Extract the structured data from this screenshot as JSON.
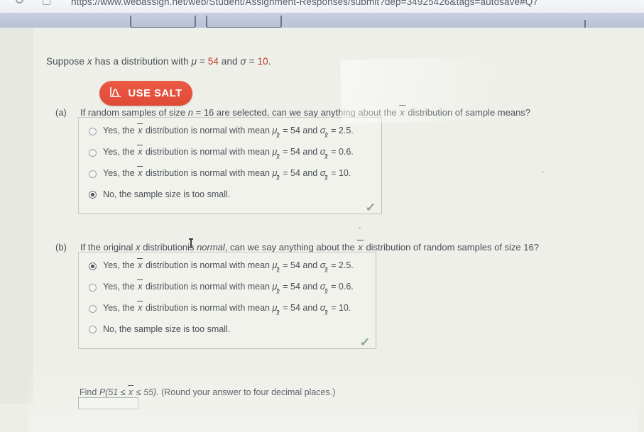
{
  "browser": {
    "url": "https://www.webassign.net/web/Student/Assignment-Responses/submit?dep=34925426&tags=autosave#Q7"
  },
  "problem": {
    "statement_prefix": "Suppose",
    "statement_var": "x",
    "statement_mid": "has a distribution with",
    "mu_symbol": "μ",
    "mu_value": "54",
    "and_text": "and",
    "sigma_symbol": "σ",
    "sigma_value": "10",
    "statement_period": "."
  },
  "salt_button": {
    "label": "USE SALT",
    "icon": "distribution-chart-icon",
    "color": "#e8503c"
  },
  "parts": [
    {
      "label": "(a)",
      "question": "If random samples of size n = 16 are selected, can we say anything about the x̄ distribution of sample means?",
      "question_pre": "If random samples of size",
      "question_n": "n",
      "question_n_eq": "= 16",
      "question_mid": "are selected, can we say anything about the",
      "question_post": "distribution of sample means?",
      "selected_index": 3,
      "options": [
        {
          "pre": "Yes, the",
          "mid": "distribution is normal with mean",
          "mu": "μ",
          "mu_sub": "x̄",
          "mu_eq": "= 54 and",
          "sigma": "σ",
          "sigma_sub": "x̄",
          "sigma_eq": "= 2.5."
        },
        {
          "pre": "Yes, the",
          "mid": "distribution is normal with mean",
          "mu": "μ",
          "mu_sub": "x̄",
          "mu_eq": "= 54 and",
          "sigma": "σ",
          "sigma_sub": "x̄",
          "sigma_eq": "= 0.6."
        },
        {
          "pre": "Yes, the",
          "mid": "distribution is normal with mean",
          "mu": "μ",
          "mu_sub": "x̄",
          "mu_eq": "= 54 and",
          "sigma": "σ",
          "sigma_sub": "x̄",
          "sigma_eq": "= 10."
        },
        {
          "plain": "No, the sample size is too small."
        }
      ],
      "feedback_icon": "green-checkmark-icon"
    },
    {
      "label": "(b)",
      "question": "If the original x distribution is normal, can we say anything about the x̄ distribution of random samples of size 16?",
      "question_pre": "If the original",
      "question_var": "x",
      "question_mid1": "distribution",
      "question_mid2": "is",
      "question_italic": "normal",
      "question_mid3": ", can we say anything about the",
      "question_post": "distribution of random samples of size 16?",
      "selected_index": 0,
      "options": [
        {
          "pre": "Yes, the",
          "mid": "distribution is normal with mean",
          "mu": "μ",
          "mu_sub": "x̄",
          "mu_eq": "= 54 and",
          "sigma": "σ",
          "sigma_sub": "x̄",
          "sigma_eq": "= 2.5."
        },
        {
          "pre": "Yes, the",
          "mid": "distribution is normal with mean",
          "mu": "μ",
          "mu_sub": "x̄",
          "mu_eq": "= 54 and",
          "sigma": "σ",
          "sigma_sub": "x̄",
          "sigma_eq": "= 0.6."
        },
        {
          "pre": "Yes, the",
          "mid": "distribution is normal with mean",
          "mu": "μ",
          "mu_sub": "x̄",
          "mu_eq": "= 54 and",
          "sigma": "σ",
          "sigma_sub": "x̄",
          "sigma_eq": "= 10."
        },
        {
          "plain": "No, the sample size is too small."
        }
      ],
      "feedback_icon": "green-checkmark-icon"
    }
  ],
  "find": {
    "prefix": "Find",
    "prob_open": "P(51 ≤",
    "prob_var": "x",
    "prob_close": "≤ 55).",
    "instruction": "(Round your answer to four decimal places.)",
    "input_value": "",
    "input_placeholder": ""
  }
}
